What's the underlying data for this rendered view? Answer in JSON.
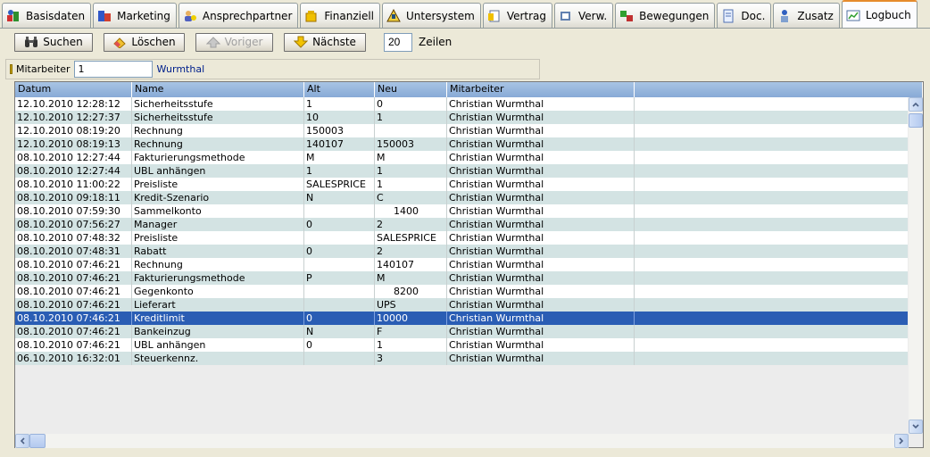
{
  "tabs": [
    {
      "label": "Basisdaten",
      "icon": "basisdaten-icon"
    },
    {
      "label": "Marketing",
      "icon": "marketing-icon"
    },
    {
      "label": "Ansprechpartner",
      "icon": "contacts-icon"
    },
    {
      "label": "Finanziell",
      "icon": "finance-icon"
    },
    {
      "label": "Untersystem",
      "icon": "subsystem-icon"
    },
    {
      "label": "Vertrag",
      "icon": "contract-icon"
    },
    {
      "label": "Verw.",
      "icon": "admin-icon"
    },
    {
      "label": "Bewegungen",
      "icon": "movements-icon"
    },
    {
      "label": "Doc.",
      "icon": "document-icon"
    },
    {
      "label": "Zusatz",
      "icon": "extra-icon"
    },
    {
      "label": "Logbuch",
      "icon": "logbook-icon"
    }
  ],
  "toolbar": {
    "search_label": "Suchen",
    "delete_label": "Löschen",
    "prev_label": "Voriger",
    "next_label": "Nächste",
    "rows_value": "20",
    "rows_label": "Zeilen"
  },
  "filter": {
    "label": "Mitarbeiter",
    "value": "1",
    "name": "Wurmthal"
  },
  "grid": {
    "columns": [
      "Datum",
      "Name",
      "Alt",
      "Neu",
      "Mitarbeiter",
      ""
    ],
    "selected_row": 16,
    "rows": [
      [
        "12.10.2010 12:28:12",
        "Sicherheitsstufe",
        "1",
        "0",
        "Christian Wurmthal"
      ],
      [
        "12.10.2010 12:27:37",
        "Sicherheitsstufe",
        "10",
        "1",
        "Christian Wurmthal"
      ],
      [
        "12.10.2010 08:19:20",
        "Rechnung",
        "150003",
        "",
        "Christian Wurmthal"
      ],
      [
        "12.10.2010 08:19:13",
        "Rechnung",
        "140107",
        "150003",
        "Christian Wurmthal"
      ],
      [
        "08.10.2010 12:27:44",
        "Fakturierungsmethode",
        "M",
        "M",
        "Christian Wurmthal"
      ],
      [
        "08.10.2010 12:27:44",
        "UBL anhängen",
        "1",
        "1",
        "Christian Wurmthal"
      ],
      [
        "08.10.2010 11:00:22",
        "Preisliste",
        "SALESPRICE",
        "1",
        "Christian Wurmthal"
      ],
      [
        "08.10.2010 09:18:11",
        "Kredit-Szenario",
        "N",
        "C",
        "Christian Wurmthal"
      ],
      [
        "08.10.2010 07:59:30",
        "Sammelkonto",
        "",
        "1400",
        "Christian Wurmthal"
      ],
      [
        "08.10.2010 07:56:27",
        "Manager",
        "0",
        "2",
        "Christian Wurmthal"
      ],
      [
        "08.10.2010 07:48:32",
        "Preisliste",
        "",
        "SALESPRICE",
        "Christian Wurmthal"
      ],
      [
        "08.10.2010 07:48:31",
        "Rabatt",
        "0",
        "2",
        "Christian Wurmthal"
      ],
      [
        "08.10.2010 07:46:21",
        "Rechnung",
        "",
        "140107",
        "Christian Wurmthal"
      ],
      [
        "08.10.2010 07:46:21",
        "Fakturierungsmethode",
        "P",
        "M",
        "Christian Wurmthal"
      ],
      [
        "08.10.2010 07:46:21",
        "Gegenkonto",
        "",
        "8200",
        "Christian Wurmthal"
      ],
      [
        "08.10.2010 07:46:21",
        "Lieferart",
        "",
        "UPS",
        "Christian Wurmthal"
      ],
      [
        "08.10.2010 07:46:21",
        "Kreditlimit",
        "0",
        "10000",
        "Christian Wurmthal"
      ],
      [
        "08.10.2010 07:46:21",
        "Bankeinzug",
        "N",
        "F",
        "Christian Wurmthal"
      ],
      [
        "08.10.2010 07:46:21",
        "UBL anhängen",
        "0",
        "1",
        "Christian Wurmthal"
      ],
      [
        "06.10.2010 16:32:01",
        "Steuerkennz.",
        "",
        "3",
        "Christian Wurmthal"
      ]
    ],
    "right_aligned_neu": [
      8,
      14
    ]
  }
}
